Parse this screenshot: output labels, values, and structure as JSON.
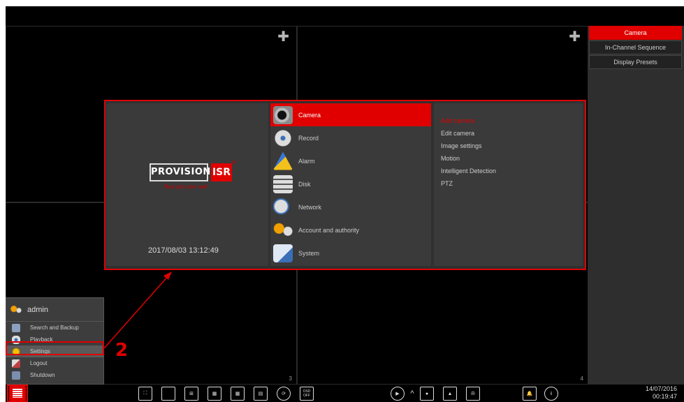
{
  "channels": [
    {
      "number": "",
      "add_icon": "plus-icon"
    },
    {
      "number": "",
      "add_icon": "plus-icon"
    },
    {
      "number": "3"
    },
    {
      "number": "4"
    }
  ],
  "right_panel": {
    "items": [
      "Camera",
      "In-Channel Sequence",
      "Display Presets"
    ],
    "active": "Camera"
  },
  "dialog": {
    "logo": {
      "brand_left": "PROVISION",
      "brand_right": "ISR",
      "tagline": "Now you can see!",
      "reg": "®"
    },
    "datetime": "2017/08/03 13:12:49",
    "menu": [
      {
        "label": "Camera",
        "icon": "camera-icon",
        "active": true
      },
      {
        "label": "Record",
        "icon": "film-reel-icon"
      },
      {
        "label": "Alarm",
        "icon": "alarm-icon"
      },
      {
        "label": "Disk",
        "icon": "disk-icon"
      },
      {
        "label": "Network",
        "icon": "network-icon"
      },
      {
        "label": "Account and authority",
        "icon": "users-icon"
      },
      {
        "label": "System",
        "icon": "system-icon"
      }
    ],
    "submenu": [
      "Add camera",
      "Edit camera",
      "Image settings",
      "Motion",
      "Intelligent Detection",
      "PTZ"
    ],
    "submenu_active": "Add camera"
  },
  "annotation": {
    "step_number": "2"
  },
  "start_menu": {
    "user": "admin",
    "items": [
      "Search and Backup",
      "Playback",
      "Settings",
      "Logout",
      "Shutdown"
    ],
    "highlighted": "Settings"
  },
  "taskbar": {
    "layout_icons": [
      "fullscreen-icon",
      "single-view-icon",
      "quad-view-icon",
      "nine-view-icon",
      "sixteen-view-icon",
      "custom-view-icon",
      "sequence-icon",
      "osd-toggle-icon"
    ],
    "osd_label": "OSD OFF",
    "play_icons": [
      "play-icon",
      "chevron-up-icon",
      "record-icon",
      "snapshot-icon",
      "playback-reel-icon"
    ],
    "right_icons": [
      "alarm-bell-icon",
      "info-icon"
    ],
    "date": "14/07/2016",
    "time": "00:19:47"
  },
  "colors": {
    "accent": "#e00000",
    "background": "#000000",
    "panel": "#2e2e2e"
  }
}
